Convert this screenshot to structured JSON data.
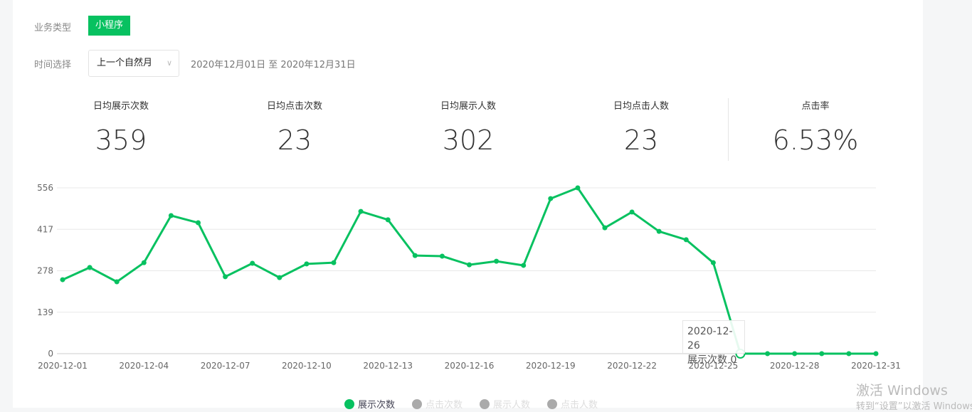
{
  "filters": {
    "biz_label": "业务类型",
    "biz_value": "小程序",
    "time_label": "时间选择",
    "time_select": "上一个自然月",
    "date_range": "2020年12月01日 至 2020年12月31日"
  },
  "stats": [
    {
      "title": "日均展示次数",
      "value": "359"
    },
    {
      "title": "日均点击次数",
      "value": "23"
    },
    {
      "title": "日均展示人数",
      "value": "302"
    },
    {
      "title": "日均点击人数",
      "value": "23"
    },
    {
      "title": "点击率",
      "value": "6.53%"
    }
  ],
  "legend": [
    {
      "label": "展示次数",
      "active": true
    },
    {
      "label": "点击次数",
      "active": false
    },
    {
      "label": "展示人数",
      "active": false
    },
    {
      "label": "点击人数",
      "active": false
    }
  ],
  "tooltip": {
    "date": "2020-12-26",
    "text": "展示次数 0"
  },
  "watermark": {
    "line1": "激活 Windows",
    "line2": "转到“设置”以激活 Windows。"
  },
  "colors": {
    "accent": "#07c160",
    "inactive": "#aaaaaa"
  },
  "chart_data": {
    "type": "line",
    "x": [
      "2020-12-01",
      "2020-12-02",
      "2020-12-03",
      "2020-12-04",
      "2020-12-05",
      "2020-12-06",
      "2020-12-07",
      "2020-12-08",
      "2020-12-09",
      "2020-12-10",
      "2020-12-11",
      "2020-12-12",
      "2020-12-13",
      "2020-12-14",
      "2020-12-15",
      "2020-12-16",
      "2020-12-17",
      "2020-12-18",
      "2020-12-19",
      "2020-12-20",
      "2020-12-21",
      "2020-12-22",
      "2020-12-23",
      "2020-12-24",
      "2020-12-25",
      "2020-12-26",
      "2020-12-27",
      "2020-12-28",
      "2020-12-29",
      "2020-12-30",
      "2020-12-31"
    ],
    "xticks": [
      "2020-12-01",
      "2020-12-04",
      "2020-12-07",
      "2020-12-10",
      "2020-12-13",
      "2020-12-16",
      "2020-12-19",
      "2020-12-22",
      "2020-12-25",
      "2020-12-28",
      "2020-12-31"
    ],
    "yticks": [
      0,
      139,
      278,
      417,
      556
    ],
    "ylim": [
      0,
      556
    ],
    "grid": true,
    "legend_position": "bottom",
    "series": [
      {
        "name": "展示次数",
        "values": [
          248,
          289,
          241,
          305,
          463,
          439,
          258,
          303,
          255,
          301,
          305,
          477,
          449,
          329,
          327,
          298,
          310,
          296,
          520,
          556,
          422,
          475,
          410,
          382,
          305,
          0,
          0,
          0,
          0,
          0,
          0
        ]
      }
    ]
  }
}
